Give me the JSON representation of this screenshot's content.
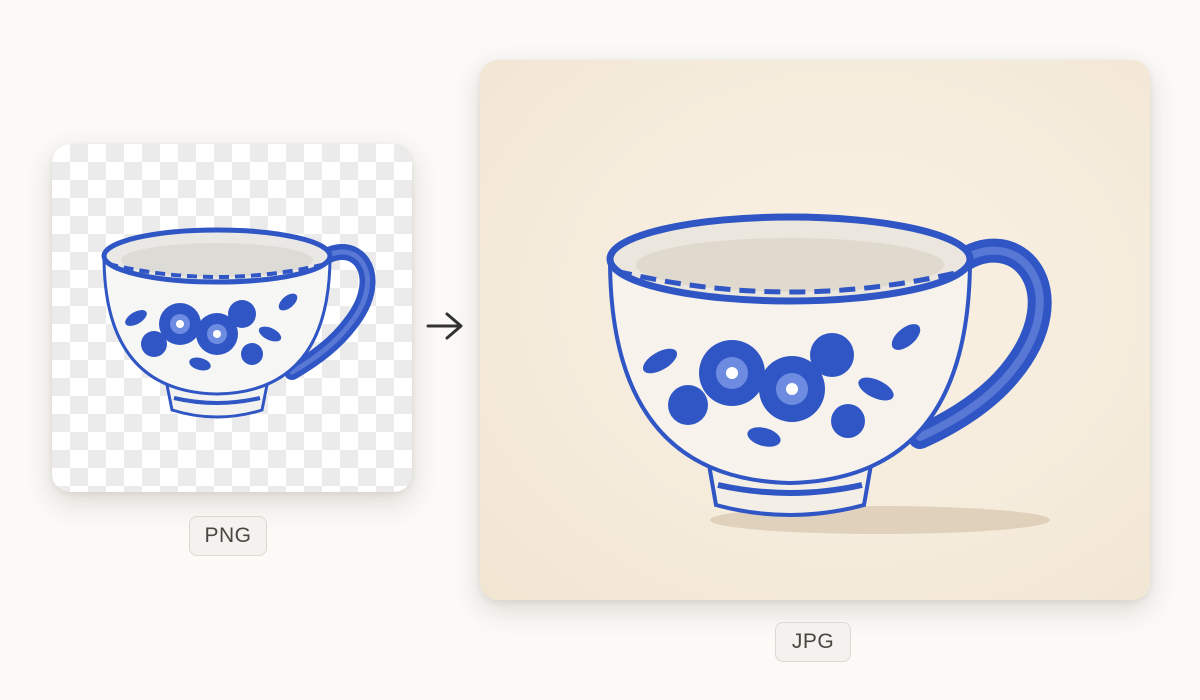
{
  "formats": {
    "source": "PNG",
    "target": "JPG"
  },
  "icons": {
    "arrow": "arrow-right-icon",
    "subject": "floral-teacup-illustration"
  },
  "colors": {
    "page_background": "#fbfaf7",
    "jpg_background": "#f5ebdb",
    "porcelain_blue": "#2f56c4",
    "label_text": "#4a4743"
  }
}
